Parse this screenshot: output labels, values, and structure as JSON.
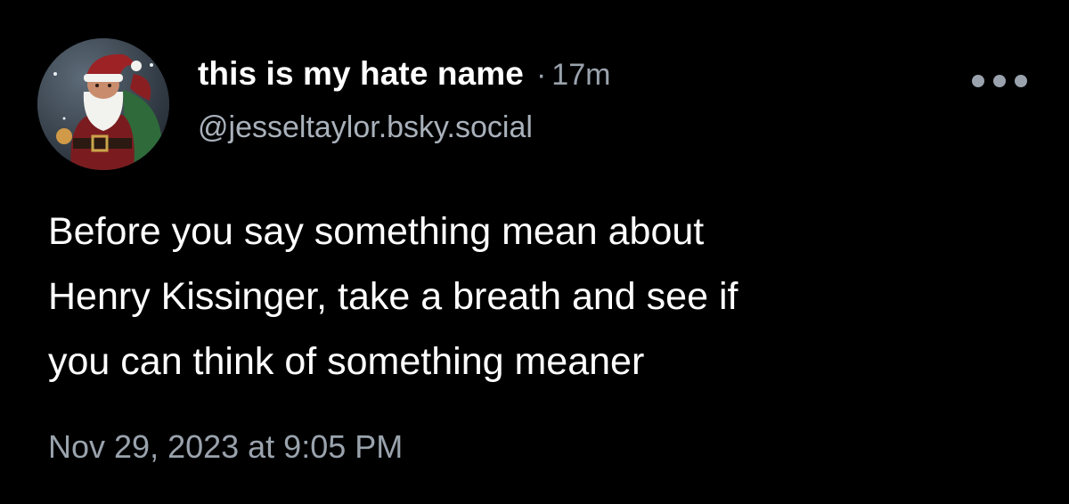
{
  "post": {
    "author": {
      "display_name": "this is my hate name",
      "handle": "@jesseltaylor.bsky.social",
      "avatar_icon": "santa-avatar"
    },
    "separator": "·",
    "time_ago": "17m",
    "menu_icon": "more-options-icon",
    "body_lines": [
      "Before you say something mean about",
      "Henry Kissinger, take a breath and see if",
      "you can think of something meaner"
    ],
    "timestamp": "Nov 29, 2023 at 9:05 PM"
  },
  "colors": {
    "background": "#000000",
    "text_primary": "#ffffff",
    "text_secondary": "#9aa3ad"
  }
}
